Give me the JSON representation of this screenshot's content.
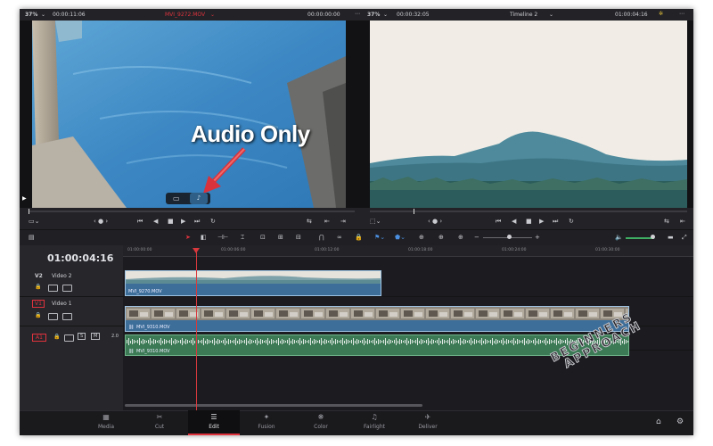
{
  "source_viewer": {
    "zoom": "37%",
    "duration": "00:00:11:06",
    "clip_name": "MVI_9272.MOV",
    "timecode": "00:00:00:00"
  },
  "timeline_viewer": {
    "zoom": "37%",
    "duration": "00:00:32:05",
    "timeline_name": "Timeline 2",
    "timecode": "01:00:04:16"
  },
  "annotation": {
    "text": "Audio Only"
  },
  "timeline": {
    "current_timecode": "01:00:04:16",
    "ruler_labels": [
      "01:00:00:00",
      "01:00:06:00",
      "01:00:12:00",
      "01:00:18:00",
      "01:00:24:00",
      "01:00:30:00"
    ],
    "tracks": [
      {
        "id": "V2",
        "name": "Video 2"
      },
      {
        "id": "V1",
        "name": "Video 1"
      },
      {
        "id": "A1",
        "name": "",
        "level": "2.0"
      }
    ],
    "clips": {
      "v2": "MVI_9270.MOV",
      "v1": "MVI_9310.MOV",
      "a1": "MVI_9310.MOV"
    }
  },
  "nav": [
    {
      "label": "Media",
      "icon": "media-icon"
    },
    {
      "label": "Cut",
      "icon": "cut-icon"
    },
    {
      "label": "Edit",
      "icon": "edit-icon",
      "active": true
    },
    {
      "label": "Fusion",
      "icon": "fusion-icon"
    },
    {
      "label": "Color",
      "icon": "color-icon"
    },
    {
      "label": "Fairlight",
      "icon": "fairlight-icon"
    },
    {
      "label": "Deliver",
      "icon": "deliver-icon"
    }
  ],
  "watermark": {
    "line1": "BEGINNERS",
    "line2": "APPROACH"
  },
  "colors": {
    "accent_red": "#e0323d",
    "video_clip": "#3d6e9a",
    "audio_clip": "#3c7a56",
    "playhead": "#d9393d"
  }
}
